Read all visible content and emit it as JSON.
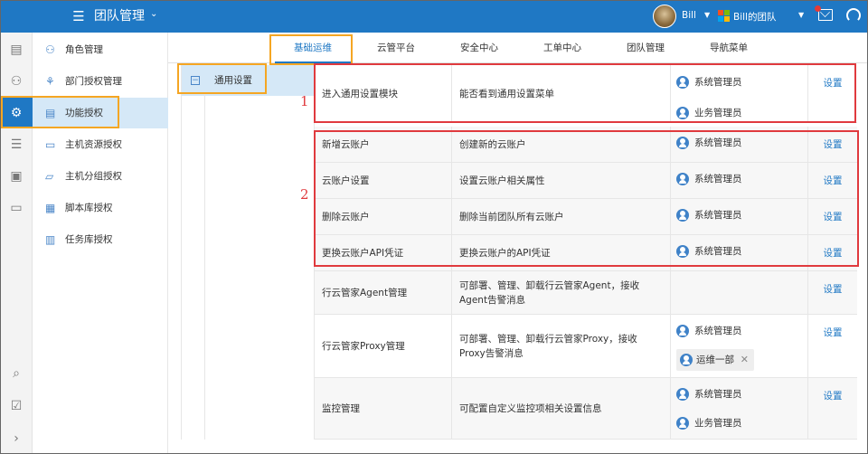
{
  "topbar": {
    "title": "团队管理",
    "user_name": "Bill",
    "team_name": "Bill的团队",
    "colors": {
      "bg": "#1f78c4",
      "notify_dot": "#e53935"
    },
    "icons": [
      "menu-icon",
      "chevron-down-icon",
      "avatar",
      "ms-logo-icon",
      "mail-icon",
      "headset-icon"
    ]
  },
  "rail": {
    "icons": [
      "document-icon",
      "users-icon",
      "user-settings-icon",
      "server-list-icon",
      "clipboard-icon",
      "bookmark-icon",
      "search-icon",
      "task-check-icon",
      "expand-right-icon"
    ],
    "active_index": 2
  },
  "sidebar": {
    "items": [
      {
        "label": "角色管理",
        "icon": "role-icon"
      },
      {
        "label": "部门授权管理",
        "icon": "org-tree-icon"
      },
      {
        "label": "功能授权",
        "icon": "list-card-icon"
      },
      {
        "label": "主机资源授权",
        "icon": "monitor-icon"
      },
      {
        "label": "主机分组授权",
        "icon": "folder-icon"
      },
      {
        "label": "脚本库授权",
        "icon": "code-icon"
      },
      {
        "label": "任务库授权",
        "icon": "task-icon"
      }
    ],
    "active_index": 2
  },
  "tabs": [
    {
      "label": "基础运维"
    },
    {
      "label": "云管平台"
    },
    {
      "label": "安全中心"
    },
    {
      "label": "工单中心"
    },
    {
      "label": "团队管理"
    },
    {
      "label": "导航菜单"
    }
  ],
  "tree": {
    "node_label": "通用设置",
    "expand_symbol": "−"
  },
  "permissions": [
    {
      "name": "进入通用设置模块",
      "desc": "能否看到通用设置菜单",
      "roles": [
        "系统管理员",
        "业务管理员"
      ],
      "action": "设置"
    },
    {
      "name": "新增云账户",
      "desc": "创建新的云账户",
      "roles": [
        "系统管理员"
      ],
      "action": "设置"
    },
    {
      "name": "云账户设置",
      "desc": "设置云账户相关属性",
      "roles": [
        "系统管理员"
      ],
      "action": "设置"
    },
    {
      "name": "删除云账户",
      "desc": "删除当前团队所有云账户",
      "roles": [
        "系统管理员"
      ],
      "action": "设置"
    },
    {
      "name": "更换云账户API凭证",
      "desc": "更换云账户的API凭证",
      "roles": [
        "系统管理员"
      ],
      "action": "设置"
    },
    {
      "name": "行云管家Agent管理",
      "desc": "可部署、管理、卸载行云管家Agent，接收Agent告警消息",
      "roles": [],
      "action": "设置"
    },
    {
      "name": "行云管家Proxy管理",
      "desc": "可部署、管理、卸载行云管家Proxy，接收Proxy告警消息",
      "roles": [
        "系统管理员"
      ],
      "dept_chip": "运维一部",
      "action": "设置"
    },
    {
      "name": "监控管理",
      "desc": "可配置自定义监控项相关设置信息",
      "roles": [
        "系统管理员",
        "业务管理员"
      ],
      "action": "设置"
    }
  ],
  "annotations": {
    "label_1": "1",
    "label_2": "2",
    "colors": {
      "orange": "#f5a623",
      "red": "#e03a3e"
    }
  }
}
